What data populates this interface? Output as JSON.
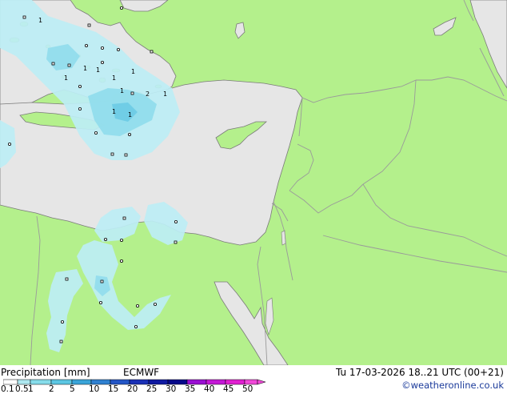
{
  "title": "Precipitation [mm]",
  "model": "ECMWF",
  "datetime": "Tu 17-03-2026 18..21 UTC (00+21)",
  "credit": "©weatheronline.co.uk",
  "legend": {
    "ticks": [
      "0.1",
      "0.5",
      "1",
      "2",
      "5",
      "10",
      "15",
      "20",
      "25",
      "30",
      "35",
      "40",
      "45",
      "50"
    ],
    "colors": [
      "#ffffff",
      "#aee8f0",
      "#86dcea",
      "#5cc6e2",
      "#3aa4d8",
      "#2f80d0",
      "#2456c6",
      "#1a30b6",
      "#101aa2",
      "#06088a",
      "#9a10d2",
      "#c418d6",
      "#e020d0",
      "#f048d8"
    ]
  },
  "colors": {
    "land": "#b4f08c",
    "sea": "#e6e6e6",
    "precip_light": "#bdeef5",
    "precip_medium": "#90dcec",
    "precip_strong": "#6ccbe4",
    "border": "#9a9a9a",
    "coast": "#7a7a7a"
  },
  "labels": [
    "1",
    "1",
    "1",
    "1",
    "1",
    "1",
    "1",
    "2",
    "1",
    "1",
    "1"
  ]
}
